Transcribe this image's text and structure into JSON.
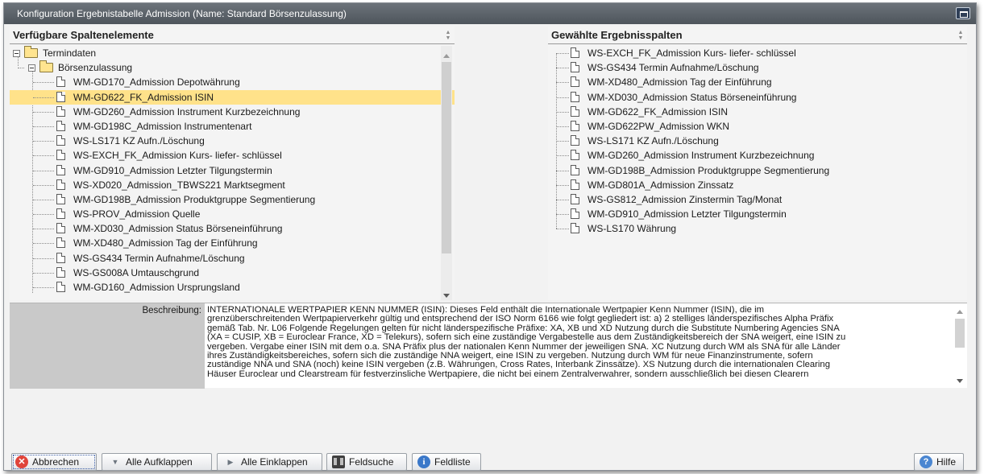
{
  "window": {
    "title": "Konfiguration Ergebnistabelle Admission (Name: Standard Börsenzulassung)"
  },
  "left_pane": {
    "heading": "Verfügbare Spaltenelemente",
    "root_folder": "Termindaten",
    "sub_folder": "Börsenzulassung",
    "items": [
      "WM-GD170_Admission Depotwährung",
      "WM-GD622_FK_Admission ISIN",
      "WM-GD260_Admission Instrument Kurzbezeichnung",
      "WM-GD198C_Admission Instrumentenart",
      "WS-LS171 KZ Aufn./Löschung",
      "WS-EXCH_FK_Admission Kurs- liefer- schlüssel",
      "WM-GD910_Admission Letzter Tilgungstermin",
      "WS-XD020_Admission_TBWS221 Marktsegment",
      "WM-GD198B_Admission Produktgruppe Segmentierung",
      "WS-PROV_Admission Quelle",
      "WM-XD030_Admission Status Börseneinführung",
      "WM-XD480_Admission Tag der Einführung",
      "WS-GS434 Termin Aufnahme/Löschung",
      "WS-GS008A Umtauschgrund",
      "WM-GD160_Admission Ursprungsland"
    ],
    "selected_index": 1
  },
  "right_pane": {
    "heading": "Gewählte Ergebnisspalten",
    "items": [
      "WS-EXCH_FK_Admission Kurs- liefer- schlüssel",
      "WS-GS434 Termin Aufnahme/Löschung",
      "WM-XD480_Admission Tag der Einführung",
      "WM-XD030_Admission Status Börseneinführung",
      "WM-GD622_FK_Admission ISIN",
      "WM-GD622PW_Admission WKN",
      "WS-LS171 KZ Aufn./Löschung",
      "WM-GD260_Admission Instrument Kurzbezeichnung",
      "WM-GD198B_Admission Produktgruppe Segmentierung",
      "WM-GD801A_Admission Zinssatz",
      "WS-GS812_Admission Zinstermin Tag/Monat",
      "WM-GD910_Admission Letzter Tilgungstermin",
      "WS-LS170 Währung"
    ]
  },
  "description": {
    "label": "Beschreibung:",
    "lines": [
      "INTERNATIONALE WERTPAPIER KENN NUMMER (ISIN): Dieses Feld enthält die Internationale Wertpapier Kenn Nummer (ISIN), die im",
      "grenzüberschreitenden Wertpapierverkehr gültig und entsprechend der ISO Norm 6166 wie folgt gegliedert ist: a) 2 stelliges länderspezifisches Alpha Präfix",
      "gemäß Tab. Nr. L06 Folgende Regelungen gelten für nicht länderspezifische Präfixe: XA, XB und XD Nutzung durch die Substitute Numbering Agencies SNA",
      "(XA = CUSIP, XB = Euroclear France, XD = Telekurs), sofern sich eine zuständige Vergabestelle aus dem Zuständigkeitsbereich der SNA weigert, eine ISIN zu",
      "vergeben. Vergabe einer ISIN mit dem o.a. SNA Präfix plus der nationalen Kenn Nummer der jeweiligen SNA. XC Nutzung durch WM als SNA für alle Länder",
      "ihres Zuständigkeitsbereiches, sofern sich die zuständige NNA weigert, eine ISIN zu vergeben. Nutzung durch WM für neue Finanzinstrumente, sofern",
      "zuständige NNA und SNA (noch) keine ISIN vergeben (z.B. Währungen, Cross Rates, Interbank Zinssätze). XS Nutzung durch die internationalen Clearing",
      "Häuser Euroclear und Clearstream für festverzinsliche Wertpapiere, die nicht bei einem Zentralverwahrer, sondern ausschließlich bei diesen Clearern"
    ]
  },
  "footer": {
    "cancel_label": "Abbrechen",
    "expand_all_label": "Alle Aufklappen",
    "collapse_all_label": "Alle Einklappen",
    "field_search_label": "Feldsuche",
    "field_list_label": "Feldliste",
    "help_label": "Hilfe"
  },
  "colors": {
    "selection": "#ffe28a",
    "titlebar": "#5a6168",
    "folder": "#ffe48f"
  }
}
